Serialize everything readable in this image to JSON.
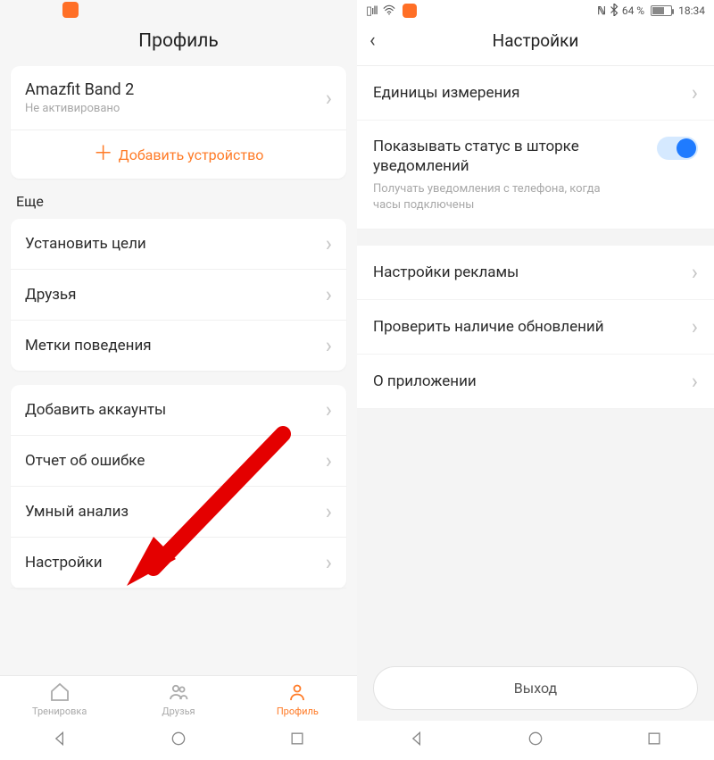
{
  "left": {
    "title": "Профиль",
    "device": {
      "name": "Amazfit Band 2",
      "status": "Не активировано"
    },
    "add_device": "Добавить устройство",
    "section_more": "Еще",
    "rows1": [
      {
        "label": "Установить цели"
      },
      {
        "label": "Друзья"
      },
      {
        "label": "Метки поведения"
      }
    ],
    "rows2": [
      {
        "label": "Добавить аккаунты"
      },
      {
        "label": "Отчет об ошибке"
      },
      {
        "label": "Умный анализ"
      },
      {
        "label": "Настройки"
      }
    ],
    "nav": {
      "workout": "Тренировка",
      "friends": "Друзья",
      "profile": "Профиль"
    }
  },
  "right": {
    "status": {
      "battery_pct": "64 %",
      "time": "18:34"
    },
    "title": "Настройки",
    "rows_top": [
      {
        "label": "Единицы измерения"
      }
    ],
    "notif": {
      "title": "Показывать статус в шторке уведомлений",
      "desc": "Получать уведомления с телефона, когда часы подключены"
    },
    "rows_mid": [
      {
        "label": "Настройки рекламы"
      },
      {
        "label": "Проверить наличие обновлений"
      },
      {
        "label": "О приложении"
      }
    ],
    "logout": "Выход"
  }
}
